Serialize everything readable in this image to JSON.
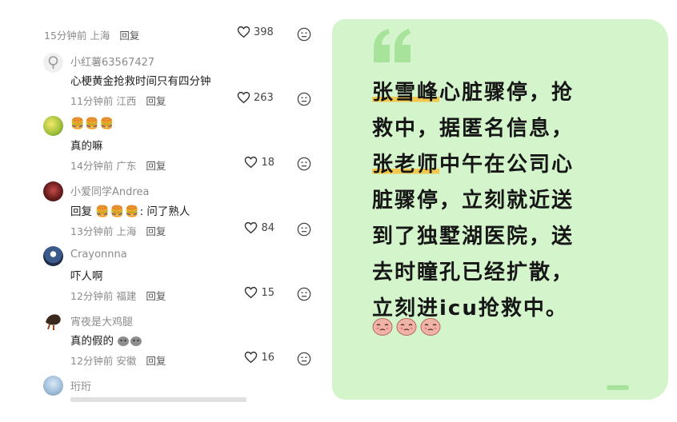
{
  "comments": {
    "items": [
      {
        "id": "c0",
        "username": "",
        "text": "",
        "time": "15分钟前",
        "location": "上海",
        "reply": "回复",
        "likes": "398"
      },
      {
        "id": "c1",
        "username": "小红薯63567427",
        "text": "心梗黄金抢救时间只有四分钟",
        "time": "11分钟前",
        "location": "江西",
        "reply": "回复",
        "likes": "263"
      },
      {
        "id": "c2",
        "username": "🍔🍔🍔",
        "text": "真的嘛",
        "time": "14分钟前",
        "location": "广东",
        "reply": "回复",
        "likes": "18"
      },
      {
        "id": "c3",
        "username": "小爱同学Andrea",
        "text_prefix": "回复",
        "text_emoji": "🍔🍔🍔",
        "text_suffix": ": 问了熟人",
        "time": "13分钟前",
        "location": "上海",
        "reply": "回复",
        "likes": "84"
      },
      {
        "id": "c4",
        "username": "Crayonnna",
        "text": "吓人啊",
        "time": "12分钟前",
        "location": "福建",
        "reply": "回复",
        "likes": "15"
      },
      {
        "id": "c5",
        "username": "宵夜是大鸡腿",
        "text": "真的假的",
        "time": "12分钟前",
        "location": "安徽",
        "reply": "回复",
        "likes": "16"
      },
      {
        "id": "c6",
        "username": "珩珩",
        "text": "",
        "time": "",
        "location": "",
        "reply": "",
        "likes": ""
      }
    ]
  },
  "card": {
    "quote_mark": "“",
    "lines": {
      "l1_hl": "张雪峰",
      "l1_rest": "心脏骤停，抢",
      "l2": "救中，据匿名信息，",
      "l3_hl": "张老师",
      "l3_rest": "中午在公司心",
      "l4": "脏骤停，立刻就近送",
      "l5": "到了独墅湖医院，送",
      "l6": "去时瞳孔已经扩散，",
      "l7": "立刻进icu抢救中。"
    },
    "face_icon": "crying-face-icon",
    "face_count": 3
  },
  "colors": {
    "card_bg": "#d4f5cc",
    "highlight": "#f2c74d",
    "quote_mark": "#a8e39c"
  }
}
